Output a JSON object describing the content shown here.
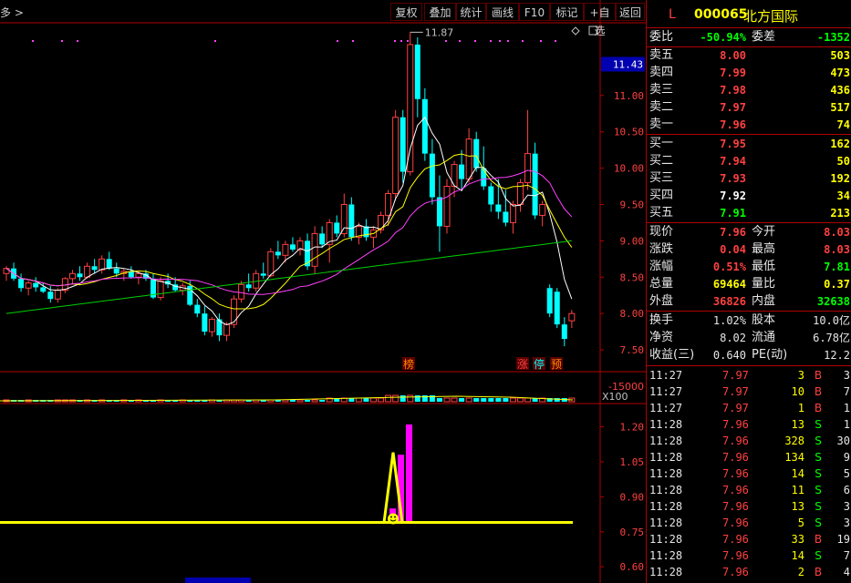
{
  "toolbar": {
    "breadcrumb": "多 >",
    "buttons": [
      "复权",
      "叠加",
      "统计",
      "画线",
      "F10",
      "标记",
      "+自选",
      "返回"
    ]
  },
  "price_axis": {
    "labels": [
      "11.00",
      "10.50",
      "10.00",
      "9.50",
      "9.00",
      "8.50",
      "8.00",
      "7.50"
    ],
    "current": "11.43"
  },
  "vol_axis": {
    "label": "15000",
    "unit": "X100"
  },
  "ind_axis": {
    "labels": [
      "1.20",
      "1.05",
      "0.90",
      "0.75",
      "0.60"
    ]
  },
  "annotations": {
    "high_label": "11.87",
    "bang": "榜",
    "zhang": "涨",
    "ting": "停",
    "yu": "预"
  },
  "chart_data": {
    "type": "candlestick",
    "ylim": [
      7.2,
      12.0
    ],
    "candles": [
      [
        8.55,
        8.65,
        8.45,
        8.62
      ],
      [
        8.62,
        8.7,
        8.45,
        8.48
      ],
      [
        8.48,
        8.55,
        8.3,
        8.35
      ],
      [
        8.35,
        8.45,
        8.25,
        8.42
      ],
      [
        8.42,
        8.5,
        8.3,
        8.36
      ],
      [
        8.36,
        8.42,
        8.28,
        8.3
      ],
      [
        8.3,
        8.38,
        8.15,
        8.2
      ],
      [
        8.2,
        8.35,
        8.15,
        8.32
      ],
      [
        8.32,
        8.5,
        8.28,
        8.48
      ],
      [
        8.48,
        8.6,
        8.4,
        8.55
      ],
      [
        8.55,
        8.65,
        8.45,
        8.5
      ],
      [
        8.5,
        8.7,
        8.48,
        8.65
      ],
      [
        8.65,
        8.75,
        8.55,
        8.6
      ],
      [
        8.6,
        8.8,
        8.55,
        8.75
      ],
      [
        8.75,
        8.85,
        8.6,
        8.62
      ],
      [
        8.62,
        8.7,
        8.5,
        8.55
      ],
      [
        8.55,
        8.62,
        8.45,
        8.58
      ],
      [
        8.58,
        8.65,
        8.48,
        8.5
      ],
      [
        8.5,
        8.58,
        8.4,
        8.55
      ],
      [
        8.55,
        8.6,
        8.45,
        8.48
      ],
      [
        8.48,
        8.55,
        8.2,
        8.22
      ],
      [
        8.22,
        8.5,
        8.18,
        8.45
      ],
      [
        8.45,
        8.55,
        8.35,
        8.4
      ],
      [
        8.4,
        8.5,
        8.3,
        8.32
      ],
      [
        8.32,
        8.42,
        8.25,
        8.38
      ],
      [
        8.38,
        8.45,
        8.1,
        8.12
      ],
      [
        8.12,
        8.2,
        7.95,
        8.0
      ],
      [
        8.0,
        8.1,
        7.7,
        7.75
      ],
      [
        7.75,
        7.95,
        7.68,
        7.92
      ],
      [
        7.92,
        8.0,
        7.62,
        7.7
      ],
      [
        7.7,
        7.88,
        7.62,
        7.85
      ],
      [
        7.85,
        8.25,
        7.8,
        8.2
      ],
      [
        8.2,
        8.45,
        8.15,
        8.4
      ],
      [
        8.4,
        8.55,
        8.3,
        8.35
      ],
      [
        8.35,
        8.6,
        8.3,
        8.55
      ],
      [
        8.55,
        8.7,
        8.48,
        8.52
      ],
      [
        8.52,
        8.9,
        8.5,
        8.85
      ],
      [
        8.85,
        9.0,
        8.75,
        8.8
      ],
      [
        8.8,
        9.0,
        8.7,
        8.95
      ],
      [
        8.95,
        9.05,
        8.85,
        8.88
      ],
      [
        8.88,
        9.05,
        8.8,
        9.0
      ],
      [
        9.0,
        9.1,
        8.6,
        8.65
      ],
      [
        8.65,
        9.2,
        8.55,
        9.1
      ],
      [
        9.1,
        9.2,
        8.9,
        8.95
      ],
      [
        8.95,
        9.3,
        8.7,
        9.25
      ],
      [
        9.25,
        9.35,
        9.05,
        9.1
      ],
      [
        9.1,
        9.65,
        9.05,
        9.5
      ],
      [
        9.5,
        9.6,
        9.0,
        9.05
      ],
      [
        9.05,
        9.25,
        8.95,
        9.2
      ],
      [
        9.2,
        9.3,
        9.0,
        9.05
      ],
      [
        9.05,
        9.2,
        8.9,
        9.15
      ],
      [
        9.15,
        9.4,
        9.1,
        9.35
      ],
      [
        9.35,
        9.7,
        9.2,
        9.65
      ],
      [
        9.65,
        10.8,
        9.55,
        10.7
      ],
      [
        10.7,
        10.8,
        9.8,
        9.95
      ],
      [
        9.95,
        11.87,
        9.9,
        11.7
      ],
      [
        11.7,
        11.8,
        10.7,
        10.95
      ],
      [
        10.95,
        11.1,
        10.1,
        10.2
      ],
      [
        10.2,
        10.4,
        9.5,
        9.6
      ],
      [
        9.6,
        9.9,
        8.85,
        9.2
      ],
      [
        9.2,
        9.85,
        9.1,
        9.75
      ],
      [
        9.75,
        10.1,
        9.6,
        10.05
      ],
      [
        10.05,
        10.25,
        9.7,
        9.85
      ],
      [
        9.85,
        10.55,
        9.8,
        10.4
      ],
      [
        10.4,
        10.5,
        9.95,
        10.0
      ],
      [
        10.0,
        10.3,
        9.7,
        9.75
      ],
      [
        9.75,
        9.8,
        9.4,
        9.5
      ],
      [
        9.5,
        9.85,
        9.3,
        9.4
      ],
      [
        9.4,
        9.7,
        9.2,
        9.25
      ],
      [
        9.25,
        9.55,
        9.1,
        9.5
      ],
      [
        9.5,
        9.85,
        9.4,
        9.8
      ],
      [
        9.8,
        10.8,
        9.7,
        10.2
      ],
      [
        10.2,
        10.35,
        9.3,
        9.35
      ],
      [
        9.35,
        9.55,
        9.2,
        9.5
      ],
      [
        8.35,
        8.4,
        7.95,
        8.0
      ],
      [
        8.3,
        8.35,
        7.8,
        7.85
      ],
      [
        7.85,
        7.95,
        7.55,
        7.65
      ],
      [
        7.9,
        8.05,
        7.8,
        8.0
      ]
    ],
    "ind": {
      "ylim": [
        0.55,
        1.28
      ],
      "baseline": 0.79,
      "spike_peak": 1.09,
      "bars": [
        0.85,
        0.9,
        1.08,
        1.21
      ]
    }
  },
  "quote": {
    "flag": "L",
    "code": "000065",
    "name": "北方国际",
    "weibi_label": "委比",
    "weibi": "-50.94%",
    "weicha_label": "委差",
    "weicha": "-1352",
    "asks": [
      {
        "l": "卖五",
        "p": "8.00",
        "v": "503"
      },
      {
        "l": "卖四",
        "p": "7.99",
        "v": "473"
      },
      {
        "l": "卖三",
        "p": "7.98",
        "v": "436"
      },
      {
        "l": "卖二",
        "p": "7.97",
        "v": "517"
      },
      {
        "l": "卖一",
        "p": "7.96",
        "v": "74"
      }
    ],
    "bids": [
      {
        "l": "买一",
        "p": "7.95",
        "v": "162"
      },
      {
        "l": "买二",
        "p": "7.94",
        "v": "50"
      },
      {
        "l": "买三",
        "p": "7.93",
        "v": "192"
      },
      {
        "l": "买四",
        "p": "7.92",
        "v": "34"
      },
      {
        "l": "买五",
        "p": "7.91",
        "v": "213"
      }
    ],
    "stats": [
      {
        "l1": "现价",
        "v1": "7.96",
        "l2": "今开",
        "v2": "8.03"
      },
      {
        "l1": "涨跌",
        "v1": "0.04",
        "l2": "最高",
        "v2": "8.03"
      },
      {
        "l1": "涨幅",
        "v1": "0.51%",
        "l2": "最低",
        "v2": "7.81"
      },
      {
        "l1": "总量",
        "v1": "69464",
        "l2": "量比",
        "v2": "0.37"
      },
      {
        "l1": "外盘",
        "v1": "36826",
        "l2": "内盘",
        "v2": "32638"
      }
    ],
    "fin": [
      {
        "l1": "换手",
        "v1": "1.02%",
        "l2": "股本",
        "v2": "10.0亿"
      },
      {
        "l1": "净资",
        "v1": "8.02",
        "l2": "流通",
        "v2": "6.78亿"
      },
      {
        "l1": "收益(三)",
        "v1": "0.640",
        "l2": "PE(动)",
        "v2": "12.2"
      }
    ],
    "ticks": [
      {
        "t": "11:27",
        "p": "7.97",
        "v": "3",
        "s": "B",
        "n": "3"
      },
      {
        "t": "11:27",
        "p": "7.97",
        "v": "10",
        "s": "B",
        "n": "7"
      },
      {
        "t": "11:27",
        "p": "7.97",
        "v": "1",
        "s": "B",
        "n": "1"
      },
      {
        "t": "11:28",
        "p": "7.96",
        "v": "13",
        "s": "S",
        "n": "1"
      },
      {
        "t": "11:28",
        "p": "7.96",
        "v": "328",
        "s": "S",
        "n": "30"
      },
      {
        "t": "11:28",
        "p": "7.96",
        "v": "134",
        "s": "S",
        "n": "9"
      },
      {
        "t": "11:28",
        "p": "7.96",
        "v": "14",
        "s": "S",
        "n": "5"
      },
      {
        "t": "11:28",
        "p": "7.96",
        "v": "11",
        "s": "S",
        "n": "6"
      },
      {
        "t": "11:28",
        "p": "7.96",
        "v": "13",
        "s": "S",
        "n": "3"
      },
      {
        "t": "11:28",
        "p": "7.96",
        "v": "5",
        "s": "S",
        "n": "3"
      },
      {
        "t": "11:28",
        "p": "7.96",
        "v": "33",
        "s": "B",
        "n": "19"
      },
      {
        "t": "11:28",
        "p": "7.96",
        "v": "14",
        "s": "S",
        "n": "7"
      },
      {
        "t": "11:28",
        "p": "7.96",
        "v": "2",
        "s": "B",
        "n": "4"
      }
    ]
  }
}
